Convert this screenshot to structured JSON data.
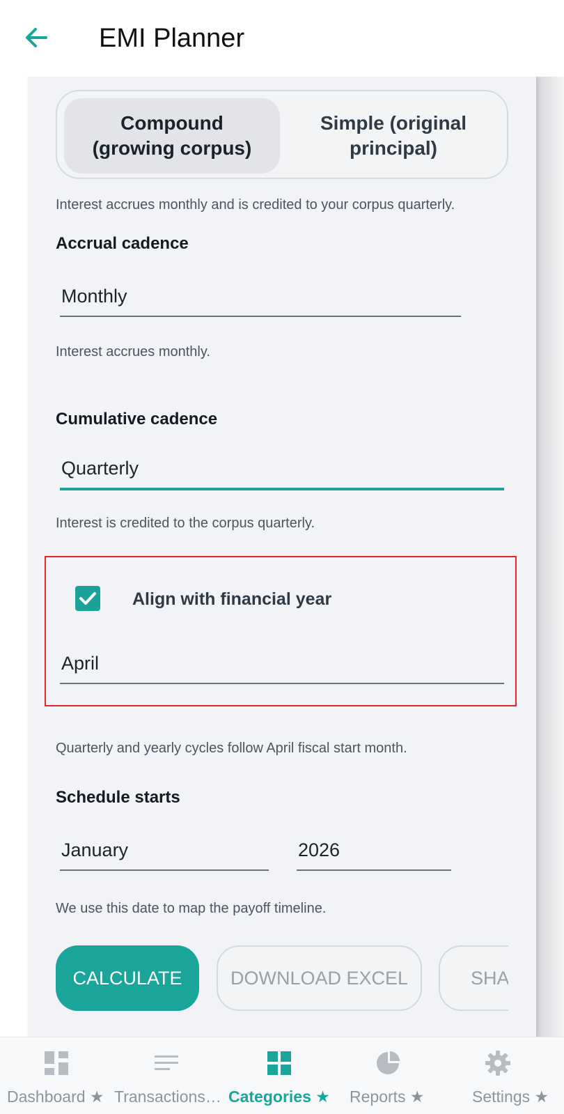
{
  "appbar": {
    "title": "EMI Planner"
  },
  "mode_toggle": {
    "options": [
      "Compound (growing corpus)",
      "Simple (original principal)"
    ],
    "selected": "Compound (growing corpus)"
  },
  "mode_helper": "Interest accrues monthly and is credited to your corpus quarterly.",
  "accrual": {
    "label": "Accrual cadence",
    "value": "Monthly",
    "helper": "Interest accrues monthly."
  },
  "cumulative": {
    "label": "Cumulative cadence",
    "value": "Quarterly",
    "helper": "Interest is credited to the corpus quarterly."
  },
  "financial_year": {
    "checkbox_label": "Align with financial year",
    "checked": true,
    "month": "April",
    "helper": "Quarterly and yearly cycles follow April fiscal start month."
  },
  "schedule": {
    "label": "Schedule starts",
    "month": "January",
    "year": "2026",
    "helper": "We use this date to map the payoff timeline."
  },
  "actions": {
    "calculate": "CALCULATE",
    "download": "DOWNLOAD EXCEL",
    "share": "SHARE"
  },
  "bottom_nav": {
    "items": [
      {
        "label": "Dashboard ★",
        "icon": "dashboard-icon"
      },
      {
        "label": "Transactions…",
        "icon": "list-icon"
      },
      {
        "label": "Categories ★",
        "icon": "grid-icon"
      },
      {
        "label": "Reports ★",
        "icon": "pie-chart-icon"
      },
      {
        "label": "Settings ★",
        "icon": "gear-icon"
      }
    ],
    "active": "Categories ★"
  },
  "colors": {
    "accent": "#19a59a",
    "highlight": "#e02828"
  }
}
